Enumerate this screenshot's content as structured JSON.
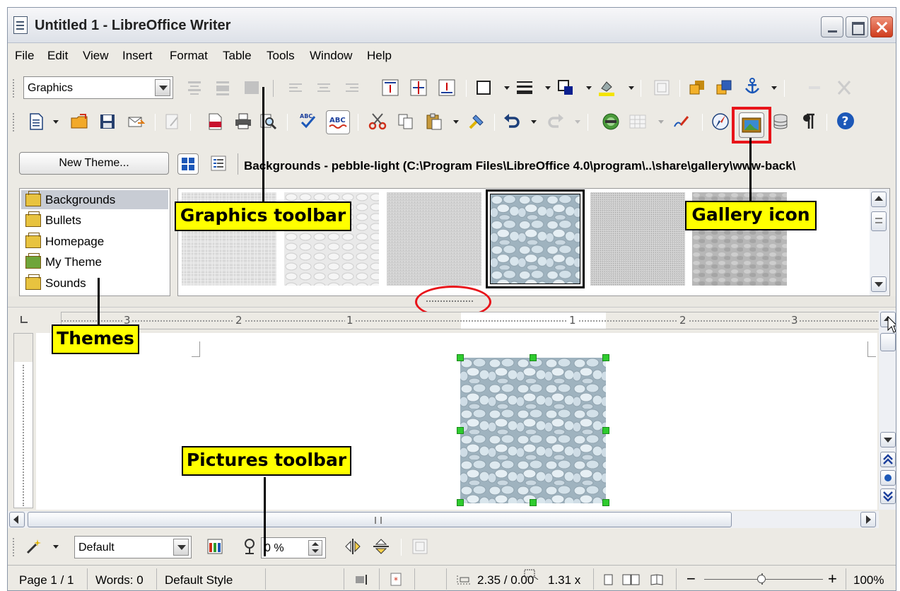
{
  "window": {
    "title": "Untitled 1 - LibreOffice Writer"
  },
  "menu": [
    "File",
    "Edit",
    "View",
    "Insert",
    "Format",
    "Table",
    "Tools",
    "Window",
    "Help"
  ],
  "graphics_toolbar": {
    "style_value": "Graphics"
  },
  "gallery": {
    "new_theme_label": "New Theme...",
    "path": "Backgrounds - pebble-light (C:\\Program Files\\LibreOffice 4.0\\program\\..\\share\\gallery\\www-back\\",
    "themes": [
      "Backgrounds",
      "Bullets",
      "Homepage",
      "My Theme",
      "Sounds"
    ],
    "selected_theme": "Backgrounds"
  },
  "ruler": {
    "labels": [
      "3",
      "2",
      "1",
      "1",
      "2",
      "3"
    ]
  },
  "pictures_toolbar": {
    "filter_value": "Default",
    "transparency_value": "0 %"
  },
  "status": {
    "page": "Page 1 / 1",
    "words": "Words: 0",
    "style": "Default Style",
    "size": "2.35 / 0.00",
    "size2": "1.31 x",
    "zoom": "100%"
  },
  "callouts": {
    "graphics_toolbar": "Graphics toolbar",
    "gallery_icon": "Gallery icon",
    "themes": "Themes",
    "pictures_toolbar": "Pictures toolbar"
  },
  "colors": {
    "callout": "#ffff00",
    "highlight": "#e8141a",
    "selection_handle": "#2ecb2e"
  }
}
